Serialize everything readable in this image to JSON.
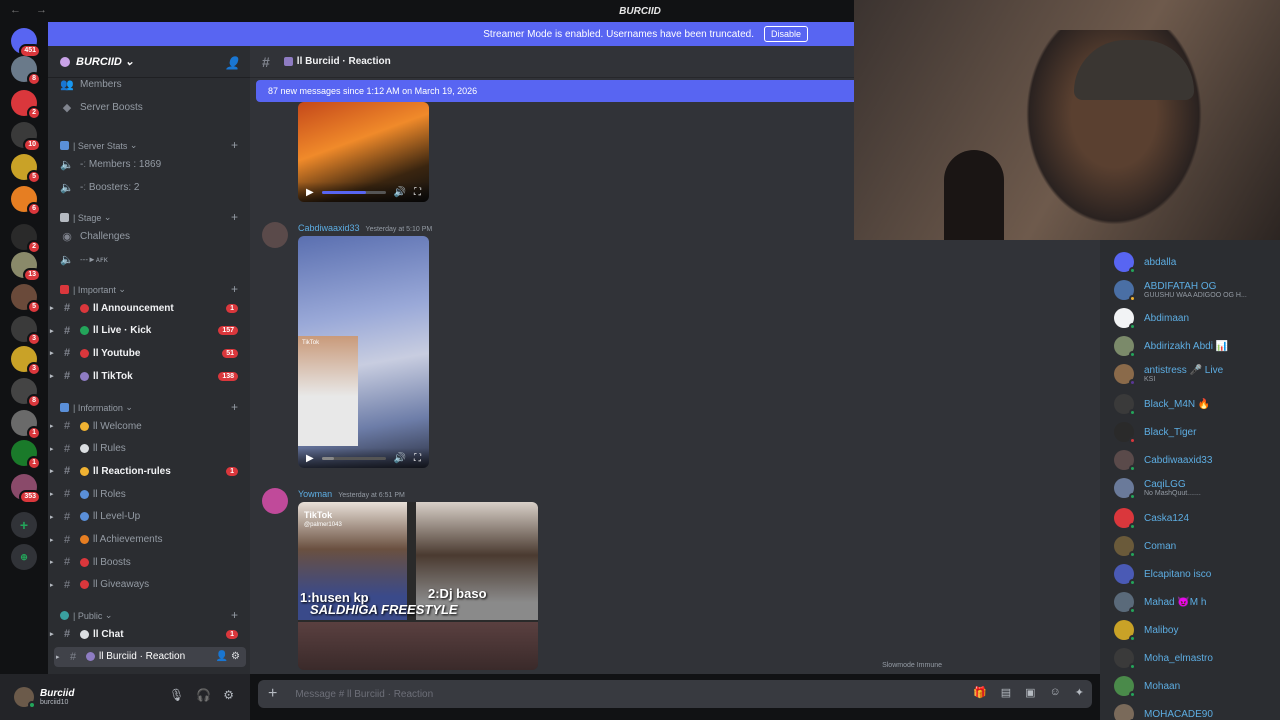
{
  "titlebar": {
    "title": "BURCIID"
  },
  "banner": {
    "text": "Streamer Mode is enabled. Usernames have been truncated.",
    "button": "Disable"
  },
  "rail": {
    "badges": [
      "451",
      "8",
      "2",
      "10",
      "5",
      "6",
      "2",
      "13",
      "5",
      "3",
      "3",
      "8",
      "1",
      "1",
      "353"
    ]
  },
  "guild": {
    "name": "BURCIID"
  },
  "sidebar": {
    "top": [
      {
        "label": "Members"
      },
      {
        "label": "Server Boosts"
      }
    ],
    "stats_category": "| Server Stats",
    "stats": [
      {
        "label": "-ː Members : 1869"
      },
      {
        "label": "-ː Boosters: 2"
      }
    ],
    "stage_category": "| Stage",
    "stage": [
      {
        "label": "Challenges"
      },
      {
        "label": "---►ᴀꜰᴋ"
      }
    ],
    "important_category": "| Important",
    "important": [
      {
        "label": "ll Announcement",
        "count": "1"
      },
      {
        "label": "ll Live · Kick",
        "count": "157"
      },
      {
        "label": "ll Youtube",
        "count": "51"
      },
      {
        "label": "ll TikTok",
        "count": "138"
      }
    ],
    "info_category": "| Information",
    "info": [
      {
        "label": "ll Welcome",
        "count": ""
      },
      {
        "label": "ll Rules",
        "count": ""
      },
      {
        "label": "ll Reaction-rules",
        "count": "1"
      },
      {
        "label": "ll Roles",
        "count": ""
      },
      {
        "label": "ll Level-Up",
        "count": ""
      },
      {
        "label": "ll Achievements",
        "count": ""
      },
      {
        "label": "ll Boosts",
        "count": ""
      },
      {
        "label": "ll Giveaways",
        "count": ""
      }
    ],
    "public_category": "| Public",
    "public": [
      {
        "label": "ll Chat",
        "count": "1"
      },
      {
        "label": "ll Burciid · Reaction",
        "count": ""
      }
    ]
  },
  "user": {
    "name": "Burciid",
    "tag": "burciid10"
  },
  "channel": {
    "name": "ll Burciid · Reaction"
  },
  "chat": {
    "new_messages": "87 new messages since 1:12 AM on March 19, 2026",
    "messages": [
      {
        "author": "Cabdiwaaxid33",
        "time": "Yesterday at 5:10 PM",
        "author_color": "#5dade2"
      },
      {
        "author": "Yowman",
        "time": "Yesterday at 6:51 PM",
        "author_color": "#5dade2"
      }
    ],
    "video_texts": [
      "TikTok",
      "@palmer1043",
      "1:husen kp",
      "2:Dj baso",
      "SALDHIGA FREESTYLE"
    ],
    "slowmode": "Slowmode Immune",
    "composer_placeholder": "Message # ll Burciid · Reaction"
  },
  "members": [
    {
      "name": "abdalla",
      "sub": "",
      "color": "#5dade2",
      "status": "#23a55a",
      "avatar": "#5865f2"
    },
    {
      "name": "ABDIFATAH OG",
      "sub": "GUUSHU WAA ADIGOO OG H...",
      "color": "#5dade2",
      "status": "#f0b232",
      "avatar": "#4a6fa5"
    },
    {
      "name": "Abdimaan",
      "sub": "",
      "color": "#5dade2",
      "status": "#23a55a",
      "avatar": "#f2f3f5"
    },
    {
      "name": "Abdirizakh Abdi 📊",
      "sub": "",
      "color": "#5dade2",
      "status": "#23a55a",
      "avatar": "#7b8a6a"
    },
    {
      "name": "antistress 🎤 Live",
      "sub": "KSI",
      "color": "#5dade2",
      "status": "#593695",
      "avatar": "#8a6a4a"
    },
    {
      "name": "Black_M4N 🔥",
      "sub": "",
      "color": "#5dade2",
      "status": "#23a55a",
      "avatar": "#3a3a3a"
    },
    {
      "name": "Black_Tiger",
      "sub": "",
      "color": "#5dade2",
      "status": "#da373c",
      "avatar": "#2a2a2a"
    },
    {
      "name": "Cabdiwaaxid33",
      "sub": "",
      "color": "#5dade2",
      "status": "#23a55a",
      "avatar": "#5a4a4a"
    },
    {
      "name": "CaqiLGG",
      "sub": "No MashQuut.......",
      "color": "#5dade2",
      "status": "#23a55a",
      "avatar": "#6a7a9a"
    },
    {
      "name": "Caska124",
      "sub": "",
      "color": "#5dade2",
      "status": "#23a55a",
      "avatar": "#da373c"
    },
    {
      "name": "Coman",
      "sub": "",
      "color": "#5dade2",
      "status": "#23a55a",
      "avatar": "#6a5a3a"
    },
    {
      "name": "Elcapitano isco",
      "sub": "",
      "color": "#5dade2",
      "status": "#23a55a",
      "avatar": "#4a5ab5"
    },
    {
      "name": "Mahad 😈M h",
      "sub": "",
      "color": "#5dade2",
      "status": "#23a55a",
      "avatar": "#5a6a7a"
    },
    {
      "name": "Maliboy",
      "sub": "",
      "color": "#5dade2",
      "status": "#23a55a",
      "avatar": "#c9a227"
    },
    {
      "name": "Moha_elmastro",
      "sub": "",
      "color": "#5dade2",
      "status": "#23a55a",
      "avatar": "#3a3a3a"
    },
    {
      "name": "Mohaan",
      "sub": "",
      "color": "#5dade2",
      "status": "#23a55a",
      "avatar": "#4a8a4a"
    },
    {
      "name": "MOHACADE90",
      "sub": "",
      "color": "#5dade2",
      "status": "#23a55a",
      "avatar": "#7a6a5a"
    }
  ]
}
